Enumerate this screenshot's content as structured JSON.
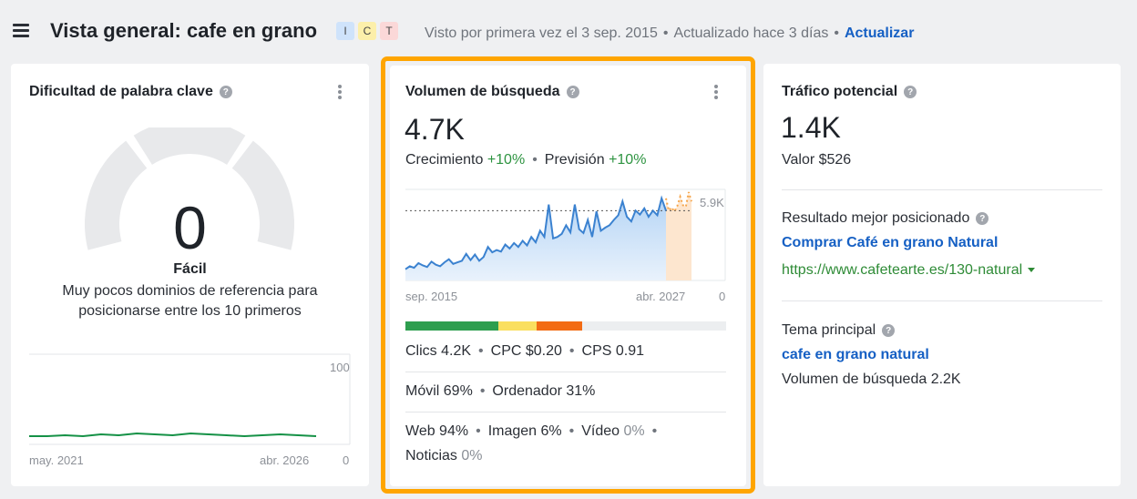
{
  "header": {
    "title": "Vista general: cafe en grano",
    "badges": [
      "I",
      "C",
      "T"
    ],
    "first_seen": "Visto por primera vez el 3 sep. 2015",
    "updated": "Actualizado hace 3 días",
    "refresh_label": "Actualizar"
  },
  "kd_card": {
    "title": "Dificultad de palabra clave",
    "value": "0",
    "label": "Fácil",
    "description": "Muy pocos dominios de referencia para posicionarse entre los 10 primeros",
    "axis_max": "100",
    "axis_min": "0",
    "x_start": "may. 2021",
    "x_end": "abr. 2026"
  },
  "volume_card": {
    "title": "Volumen de búsqueda",
    "value": "4.7K",
    "growth_label": "Crecimiento",
    "growth_value": "+10%",
    "forecast_label": "Previsión",
    "forecast_value": "+10%",
    "chart_max_label": "5.9K",
    "chart_min_label": "0",
    "x_start": "sep. 2015",
    "x_end": "abr. 2027",
    "clicks": "Clics 4.2K",
    "cpc": "CPC $0.20",
    "cps": "CPS 0.91",
    "mobile": "Móvil 69%",
    "desktop": "Ordenador 31%",
    "web": "Web 94%",
    "image": "Imagen 6%",
    "video_label": "Vídeo",
    "video_value": "0%",
    "news_label": "Noticias",
    "news_value": "0%",
    "bar_segments": [
      {
        "color": "#2e9e4f",
        "fraction": 0.29
      },
      {
        "color": "#fadf5f",
        "fraction": 0.12
      },
      {
        "color": "#f36b13",
        "fraction": 0.14
      },
      {
        "color": "#eceef0",
        "fraction": 0.45
      }
    ]
  },
  "traffic_card": {
    "title": "Tráfico potencial",
    "value": "1.4K",
    "value_text": "Valor $526",
    "top_result_label": "Resultado mejor posicionado",
    "top_result_title": "Comprar Café en grano Natural",
    "top_result_url": "https://www.cafetearte.es/130-natural",
    "topic_label": "Tema principal",
    "topic_value": "cafe en grano natural",
    "topic_volume": "Volumen de búsqueda 2.2K"
  },
  "colors": {
    "accent_link": "#1660c4",
    "positive": "#2e9441",
    "highlight_border": "#ffa500"
  },
  "chart_data": [
    {
      "type": "line",
      "title": "",
      "series": [
        {
          "values": [
            2,
            2,
            3,
            2,
            4,
            3,
            5,
            4,
            3,
            5,
            4,
            3,
            2,
            3,
            4,
            3,
            2
          ]
        }
      ],
      "ylim": [
        0,
        100
      ],
      "x_range": [
        "may. 2021",
        "abr. 2026"
      ]
    },
    {
      "type": "area",
      "title": "",
      "x_range": [
        "sep. 2015",
        "abr. 2027"
      ],
      "ylim": [
        0,
        5900
      ],
      "series": [
        {
          "values": [
            900,
            1100,
            1000,
            1300,
            1150,
            1050,
            1400,
            1200,
            1100,
            1350,
            1550,
            1250,
            1350,
            1450,
            1900,
            1500,
            1850,
            1450,
            1700,
            2350,
            2000,
            2150,
            2050,
            2500,
            2250,
            2600,
            2350,
            2750,
            2450,
            3000,
            2650,
            3400,
            3000,
            5100,
            2900,
            3000,
            3200,
            3750,
            3300,
            5100,
            3500,
            3250,
            4100,
            3000,
            4650,
            3400,
            3600,
            3750,
            4100,
            4400,
            5300,
            4300,
            4000,
            4700,
            4450,
            4850,
            4300,
            4700,
            4400,
            5500,
            4700
          ]
        },
        {
          "values": [
            5500,
            4700,
            4900,
            4650,
            5000,
            5600,
            5050,
            4950,
            5900,
            5300
          ]
        }
      ]
    }
  ]
}
